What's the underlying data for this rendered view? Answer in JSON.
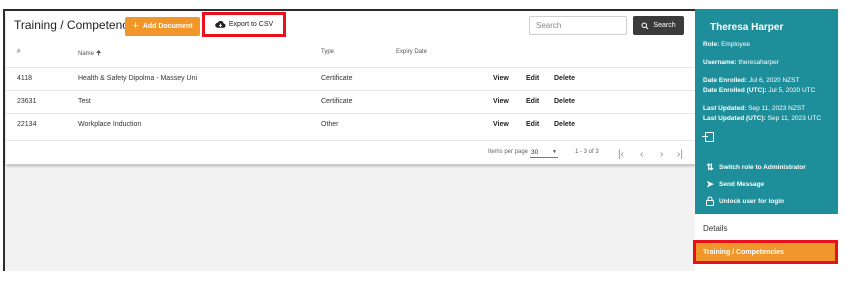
{
  "header": {
    "title": "Training / Competencies",
    "add_document_label": "Add Document",
    "export_label": "Export to CSV",
    "search_placeholder": "Search",
    "search_button_label": "Search"
  },
  "table": {
    "columns": [
      "#",
      "Name",
      "Type",
      "Expiry Date"
    ],
    "sort_column": "Name",
    "sort_direction": "ascending",
    "rows": [
      {
        "id": "4118",
        "name": "Health & Safety Dipolma - Massey Uni",
        "type": "Certificate",
        "expiry": ""
      },
      {
        "id": "23631",
        "name": "Test",
        "type": "Certificate",
        "expiry": ""
      },
      {
        "id": "22134",
        "name": "Workplace Induction",
        "type": "Other",
        "expiry": ""
      }
    ],
    "row_actions": [
      "View",
      "Edit",
      "Delete"
    ]
  },
  "pagination": {
    "items_per_page_label": "Items per page",
    "items_per_page": "30",
    "range_label": "1 - 3 of 3"
  },
  "profile": {
    "name": "Theresa Harper",
    "lines": [
      {
        "label": "Role:",
        "value": "Employee"
      },
      {
        "label": "Username:",
        "value": "theresaharper"
      },
      {
        "label": "Date Enrolled:",
        "value": "Jul 6, 2020 NZST"
      },
      {
        "label": "Date Enrolled (UTC):",
        "value": "Jul 5, 2020 UTC"
      },
      {
        "label": "Last Updated:",
        "value": "Sep 11, 2023 NZST"
      },
      {
        "label": "Last Updated (UTC):",
        "value": "Sep 11, 2023 UTC"
      }
    ],
    "actions": {
      "switch_role": "Switch role to Administrator",
      "send_message": "Send Message",
      "unlock": "Unlock user for login"
    }
  },
  "side_nav": {
    "details": "Details",
    "training": "Training / Competencies"
  },
  "colors": {
    "accent_orange": "#f0962b",
    "panel_teal": "#1e8e9a",
    "highlight_red": "#e8111b",
    "dark_button": "#3b3b3b"
  }
}
